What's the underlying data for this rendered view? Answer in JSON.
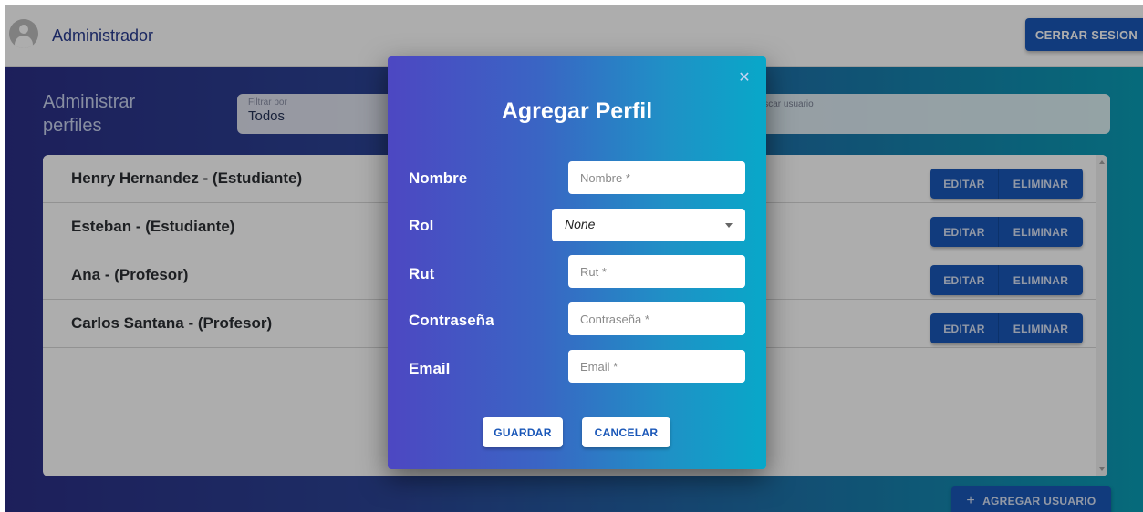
{
  "header": {
    "user_name": "Administrador",
    "logout_label": "CERRAR SESION"
  },
  "page": {
    "title": "Administrar perfiles",
    "filter_label": "Filtrar por",
    "filter_value": "Todos",
    "search_placeholder": "Buscar usuario"
  },
  "profiles": [
    {
      "name": "Henry Hernandez - (Estudiante)",
      "edit_label": "EDITAR",
      "delete_label": "ELIMINAR"
    },
    {
      "name": "Esteban - (Estudiante)",
      "edit_label": "EDITAR",
      "delete_label": "ELIMINAR"
    },
    {
      "name": "Ana - (Profesor)",
      "edit_label": "EDITAR",
      "delete_label": "ELIMINAR"
    },
    {
      "name": "Carlos Santana - (Profesor)",
      "edit_label": "EDITAR",
      "delete_label": "ELIMINAR"
    }
  ],
  "add_user_label": "AGREGAR USUARIO",
  "modal": {
    "title": "Agregar Perfil",
    "close_icon": "close-icon",
    "fields": {
      "nombre_label": "Nombre",
      "nombre_placeholder": "Nombre *",
      "rol_label": "Rol",
      "rol_value": "None",
      "rut_label": "Rut",
      "rut_placeholder": "Rut *",
      "password_label": "Contraseña",
      "password_placeholder": "Contraseña *",
      "email_label": "Email",
      "email_placeholder": "Email *"
    },
    "save_label": "GUARDAR",
    "cancel_label": "CANCELAR"
  },
  "colors": {
    "primary_button": "#1a57b8",
    "gradient_start": "#2c2f86",
    "gradient_end": "#0a9db5"
  }
}
